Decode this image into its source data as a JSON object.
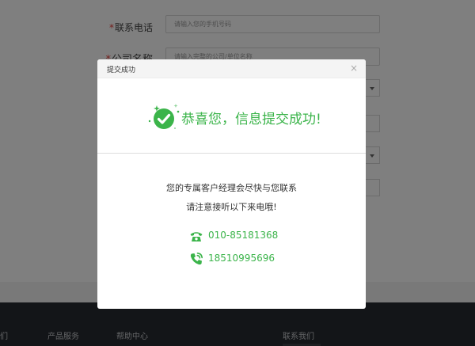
{
  "form": {
    "phone_label": "联系电话",
    "phone_placeholder": "请输入您的手机号码",
    "company_label": "公司名称",
    "company_placeholder": "请输入完整的公司/单位名称"
  },
  "footer": {
    "links": [
      "们",
      "产品服务",
      "帮助中心",
      "联系我们"
    ]
  },
  "dialog": {
    "title": "提交成功",
    "close": "×",
    "success_message": "恭喜您，信息提交成功!",
    "line1": "您的专属客户经理会尽快与您联系",
    "line2": "请注意接听以下来电哦!",
    "phone1": "010-85181368",
    "phone2": "18510995696"
  },
  "icons": {
    "success": "check-circle-icon",
    "landline": "telephone-icon",
    "mobile": "phone-call-icon"
  },
  "colors": {
    "accent_green": "#3bb44a",
    "required_star": "#e5403b",
    "footer_bg": "#262a31"
  }
}
